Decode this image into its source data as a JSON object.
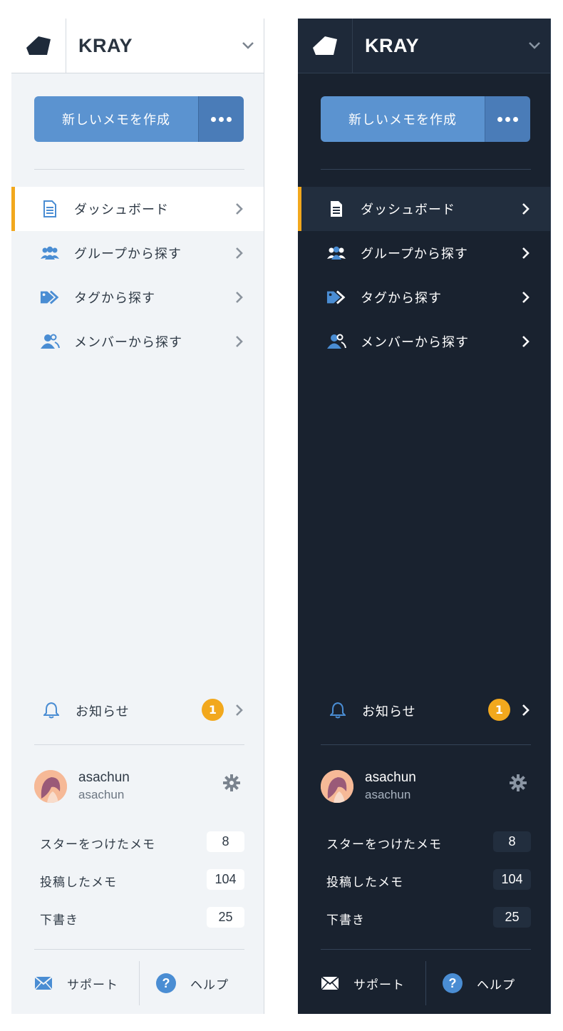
{
  "app": {
    "name": "KRAY"
  },
  "create": {
    "label": "新しいメモを作成"
  },
  "nav": [
    {
      "label": "ダッシュボード",
      "icon": "document-icon",
      "active": true
    },
    {
      "label": "グループから探す",
      "icon": "group-icon",
      "active": false
    },
    {
      "label": "タグから探す",
      "icon": "tag-icon",
      "active": false
    },
    {
      "label": "メンバーから探す",
      "icon": "member-icon",
      "active": false
    }
  ],
  "notice": {
    "label": "お知らせ",
    "count": "1"
  },
  "user": {
    "name": "asachun",
    "id": "asachun"
  },
  "stats": [
    {
      "label": "スターをつけたメモ",
      "count": "8"
    },
    {
      "label": "投稿したメモ",
      "count": "104"
    },
    {
      "label": "下書き",
      "count": "25"
    }
  ],
  "footer": {
    "support": "サポート",
    "help": "ヘルプ"
  },
  "colors": {
    "accent": "#5b93d0",
    "active_bar": "#f2a81d",
    "light_bg": "#f1f4f7",
    "dark_bg": "#19222f",
    "icon_blue": "#4a8dd3"
  }
}
